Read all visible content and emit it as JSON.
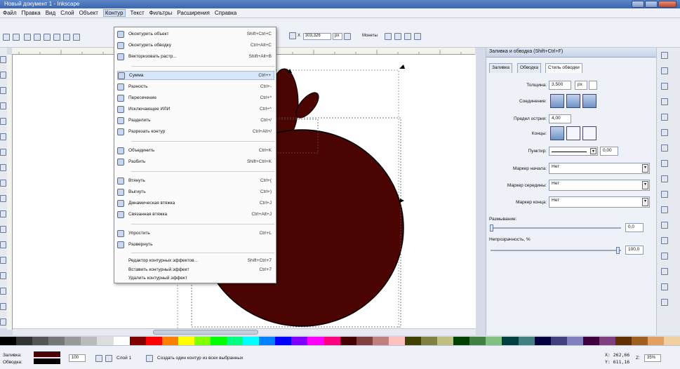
{
  "window": {
    "title": "Новый документ 1 - Inkscape"
  },
  "menubar": [
    "Файл",
    "Правка",
    "Вид",
    "Слой",
    "Объект",
    "Контур",
    "Текст",
    "Фильтры",
    "Расширения",
    "Справка"
  ],
  "toolbar": {
    "x_value": "303,326",
    "units": "px",
    "snap_label": "Монеты"
  },
  "contour_menu": {
    "items": [
      {
        "label": "Оконтурить объект",
        "shortcut": "Shift+Ctrl+C"
      },
      {
        "label": "Оконтурить обводку",
        "shortcut": "Ctrl+Alt+C"
      },
      {
        "label": "Векторизовать растр...",
        "shortcut": "Shift+Alt+B"
      },
      {
        "label": "Сумма",
        "shortcut": "Ctrl++"
      },
      {
        "label": "Разность",
        "shortcut": "Ctrl+-"
      },
      {
        "label": "Пересечение",
        "shortcut": "Ctrl+*"
      },
      {
        "label": "Исключающее ИЛИ",
        "shortcut": "Ctrl+^"
      },
      {
        "label": "Разделить",
        "shortcut": "Ctrl+/"
      },
      {
        "label": "Разрезать контур",
        "shortcut": "Ctrl+Alt+/"
      },
      {
        "label": "Объединить",
        "shortcut": "Ctrl+K"
      },
      {
        "label": "Разбить",
        "shortcut": "Shift+Ctrl+K"
      },
      {
        "label": "Втянуть",
        "shortcut": "Ctrl+("
      },
      {
        "label": "Выгнуть",
        "shortcut": "Ctrl+)"
      },
      {
        "label": "Динамическая втяжка",
        "shortcut": "Ctrl+J"
      },
      {
        "label": "Связанная втяжка",
        "shortcut": "Ctrl+Alt+J"
      },
      {
        "label": "Упростить",
        "shortcut": "Ctrl+L"
      },
      {
        "label": "Развернуть",
        "shortcut": ""
      },
      {
        "label": "Редактор контурных эффектов...",
        "shortcut": "Shift+Ctrl+7"
      },
      {
        "label": "Вставить контурный эффект",
        "shortcut": "Ctrl+7"
      },
      {
        "label": "Удалить контурный эффект",
        "shortcut": ""
      }
    ]
  },
  "panel": {
    "title": "Заливка и обводка (Shift+Ctrl+F)",
    "tabs": [
      "Заливка",
      "Обводка",
      "Стиль обводки"
    ],
    "width_label": "Толщина:",
    "width_value": "3,500",
    "width_unit": "px",
    "join_label": "Соединение:",
    "miter_label": "Предел острия:",
    "miter_value": "4,00",
    "cap_label": "Концы:",
    "dash_label": "Пунктир:",
    "dash_value": "0,00",
    "start_marker_label": "Маркер начала:",
    "start_marker_value": "Нет",
    "mid_marker_label": "Маркер середины:",
    "mid_marker_value": "Нет",
    "end_marker_label": "Маркер конца:",
    "end_marker_value": "Нет",
    "blur_label": "Размывание:",
    "blur_value": "0,0",
    "opacity_label": "Непрозрачность, %",
    "opacity_value": "100,0"
  },
  "status": {
    "fill_label": "Заливка:",
    "stroke_label": "Обводка:",
    "opacity_value": "100",
    "layer": "Слой 1",
    "message": "Создать один контур из всех выбранных",
    "x": "X: 262,66",
    "y": "Y: 611,16",
    "zoom": "35%"
  },
  "colors": {
    "shape_fill": "#4a0503",
    "accent": "#3b66ad"
  }
}
